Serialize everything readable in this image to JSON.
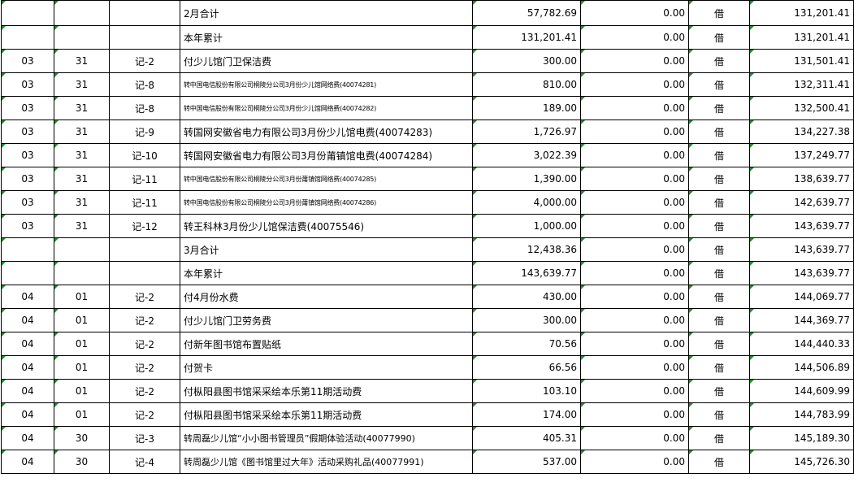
{
  "ledger": {
    "rows": [
      {
        "month": "",
        "day": "",
        "voucher": "",
        "summary": "2月合计",
        "debit": "57,782.69",
        "credit": "0.00",
        "direction": "借",
        "balance": "131,201.41"
      },
      {
        "month": "",
        "day": "",
        "voucher": "",
        "summary": "本年累计",
        "debit": "131,201.41",
        "credit": "0.00",
        "direction": "借",
        "balance": "131,201.41"
      },
      {
        "month": "03",
        "day": "31",
        "voucher": "记-2",
        "summary": "付少儿馆门卫保洁费",
        "debit": "300.00",
        "credit": "0.00",
        "direction": "借",
        "balance": "131,501.41"
      },
      {
        "month": "03",
        "day": "31",
        "voucher": "记-8",
        "summary": "转中国电信股份有限公司桐陵分公司3月份少儿馆网络费(40074281)",
        "debit": "810.00",
        "credit": "0.00",
        "direction": "借",
        "balance": "132,311.41",
        "small": true
      },
      {
        "month": "03",
        "day": "31",
        "voucher": "记-8",
        "summary": "转中国电信股份有限公司桐陵分公司3月份少儿馆网络费(40074282)",
        "debit": "189.00",
        "credit": "0.00",
        "direction": "借",
        "balance": "132,500.41",
        "small": true
      },
      {
        "month": "03",
        "day": "31",
        "voucher": "记-9",
        "summary": "转国网安徽省电力有限公司3月份少儿馆电费(40074283)",
        "debit": "1,726.97",
        "credit": "0.00",
        "direction": "借",
        "balance": "134,227.38"
      },
      {
        "month": "03",
        "day": "31",
        "voucher": "记-10",
        "summary": "转国网安徽省电力有限公司3月份莆镇馆电费(40074284)",
        "debit": "3,022.39",
        "credit": "0.00",
        "direction": "借",
        "balance": "137,249.77"
      },
      {
        "month": "03",
        "day": "31",
        "voucher": "记-11",
        "summary": "转中国电信股份有限公司桐陵分公司3月份莆镇馆网络费(40074285)",
        "debit": "1,390.00",
        "credit": "0.00",
        "direction": "借",
        "balance": "138,639.77",
        "small": true
      },
      {
        "month": "03",
        "day": "31",
        "voucher": "记-11",
        "summary": "转中国电信股份有限公司桐陵分公司3月份莆镇馆网络费(40074286)",
        "debit": "4,000.00",
        "credit": "0.00",
        "direction": "借",
        "balance": "142,639.77",
        "small": true
      },
      {
        "month": "03",
        "day": "31",
        "voucher": "记-12",
        "summary": "转王科林3月份少儿馆保洁费(40075546)",
        "debit": "1,000.00",
        "credit": "0.00",
        "direction": "借",
        "balance": "143,639.77"
      },
      {
        "month": "",
        "day": "",
        "voucher": "",
        "summary": "3月合计",
        "debit": "12,438.36",
        "credit": "0.00",
        "direction": "借",
        "balance": "143,639.77"
      },
      {
        "month": "",
        "day": "",
        "voucher": "",
        "summary": "本年累计",
        "debit": "143,639.77",
        "credit": "0.00",
        "direction": "借",
        "balance": "143,639.77"
      },
      {
        "month": "04",
        "day": "01",
        "voucher": "记-2",
        "summary": "付4月份水费",
        "debit": "430.00",
        "credit": "0.00",
        "direction": "借",
        "balance": "144,069.77"
      },
      {
        "month": "04",
        "day": "01",
        "voucher": "记-2",
        "summary": "付少儿馆门卫劳务费",
        "debit": "300.00",
        "credit": "0.00",
        "direction": "借",
        "balance": "144,369.77"
      },
      {
        "month": "04",
        "day": "01",
        "voucher": "记-2",
        "summary": "付新年图书馆布置贴纸",
        "debit": "70.56",
        "credit": "0.00",
        "direction": "借",
        "balance": "144,440.33"
      },
      {
        "month": "04",
        "day": "01",
        "voucher": "记-2",
        "summary": "付贺卡",
        "debit": "66.56",
        "credit": "0.00",
        "direction": "借",
        "balance": "144,506.89"
      },
      {
        "month": "04",
        "day": "01",
        "voucher": "记-2",
        "summary": "付枞阳县图书馆采采绘本乐第11期活动费",
        "debit": "103.10",
        "credit": "0.00",
        "direction": "借",
        "balance": "144,609.99"
      },
      {
        "month": "04",
        "day": "01",
        "voucher": "记-2",
        "summary": "付枞阳县图书馆采采绘本乐第11期活动费",
        "debit": "174.00",
        "credit": "0.00",
        "direction": "借",
        "balance": "144,783.99"
      },
      {
        "month": "04",
        "day": "30",
        "voucher": "记-3",
        "summary": "转周磊少儿馆“小小图书管理员”假期体验活动(40077990)",
        "debit": "405.31",
        "credit": "0.00",
        "direction": "借",
        "balance": "145,189.30",
        "mid": true
      },
      {
        "month": "04",
        "day": "30",
        "voucher": "记-4",
        "summary": "转周磊少儿馆《图书馆里过大年》活动采购礼品(40077991)",
        "debit": "537.00",
        "credit": "0.00",
        "direction": "借",
        "balance": "145,726.30",
        "mid": true
      }
    ]
  }
}
